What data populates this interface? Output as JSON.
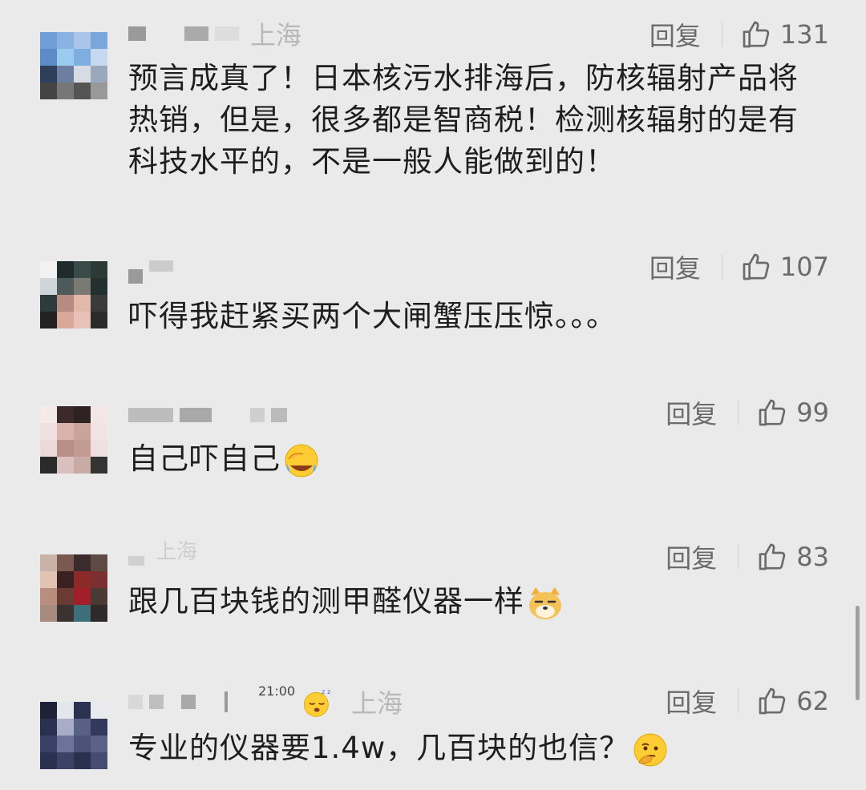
{
  "comments": [
    {
      "location": "上海",
      "reply_label": "回复",
      "likes": "131",
      "text": "预言成真了！日本核污水排海后，防核辐射产品将热销，但是，很多都是智商税！检测核辐射的是有科技水平的，不是一般人能做到的！"
    },
    {
      "reply_label": "回复",
      "likes": "107",
      "text": "吓得我赶紧买两个大闸蟹压压惊。。。"
    },
    {
      "reply_label": "回复",
      "likes": "99",
      "text": "自己吓自己",
      "emoji": "facepalm-crying-emoji"
    },
    {
      "location": "上海",
      "reply_label": "回复",
      "likes": "83",
      "text": "跟几百块钱的测甲醛仪器一样",
      "emoji": "doge-emoji"
    },
    {
      "time": "21:00",
      "status_emoji": "sleeping-emoji",
      "location": "上海",
      "reply_label": "回复",
      "likes": "62",
      "text": "专业的仪器要1.4w，几百块的也信？",
      "emoji": "thinking-emoji"
    }
  ],
  "icons": {
    "like": "thumbs-up-icon"
  },
  "colors": {
    "background": "#eaeaea",
    "meta": "#b3b3b3",
    "action": "#6b6b6b",
    "text": "#1e1e1e"
  }
}
